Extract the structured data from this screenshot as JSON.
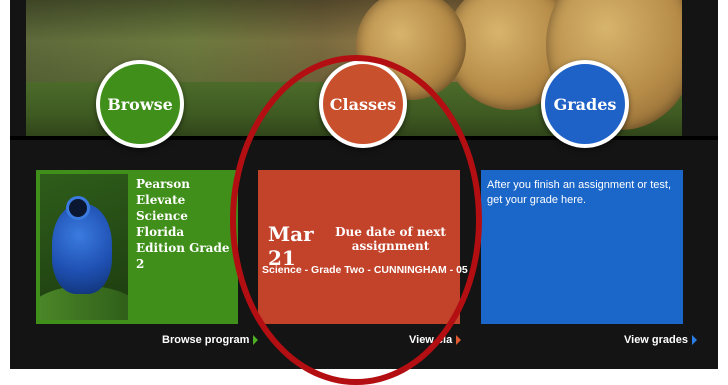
{
  "nav": {
    "browse_label": "Browse",
    "classes_label": "Classes",
    "grades_label": "Grades"
  },
  "program_card": {
    "title": "Pearson Elevate Science Florida Edition Grade 2",
    "link_label": "Browse program"
  },
  "class_card": {
    "date": "Mar 21",
    "date_label": "Due date of next assignment",
    "class_name": "Science - Grade Two - CUNNINGHAM - 05",
    "link_label": "View cla"
  },
  "grades_card": {
    "text": "After you finish an assignment or test, get your grade here.",
    "link_label": "View grades"
  },
  "colors": {
    "browse": "#3f8f1a",
    "classes": "#c2422a",
    "grades": "#1a66c9",
    "annotation": "#b30f12"
  }
}
